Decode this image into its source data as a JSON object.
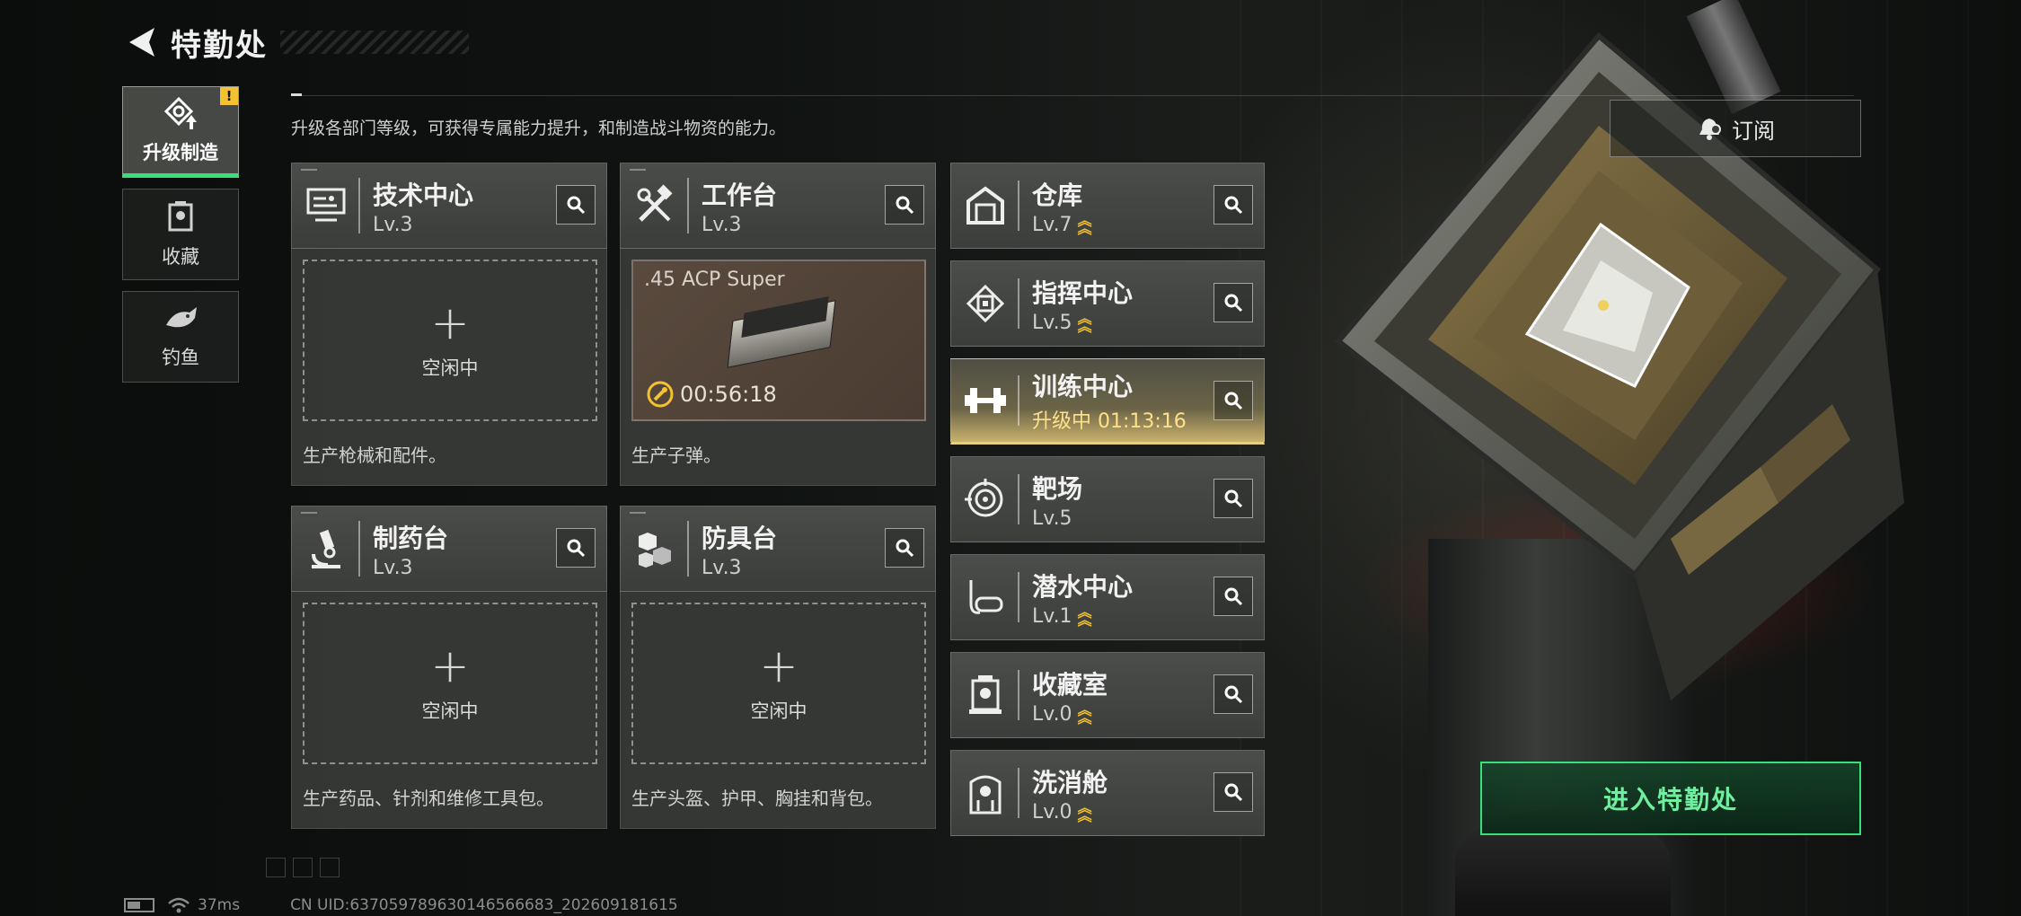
{
  "header": {
    "title": "特勤处"
  },
  "nav": {
    "items": [
      {
        "label": "升级制造",
        "badge": "!"
      },
      {
        "label": "收藏"
      },
      {
        "label": "钓鱼"
      }
    ]
  },
  "description": "升级各部门等级，可获得专属能力提升，和制造战斗物资的能力。",
  "subscribe": {
    "label": "订阅"
  },
  "production": [
    {
      "name": "技术中心",
      "level": "Lv.3",
      "slot_status": "空闲中",
      "desc": "生产枪械和配件。",
      "icon": "monitor-icon"
    },
    {
      "name": "工作台",
      "level": "Lv.3",
      "item": ".45 ACP Super",
      "timer": "00:56:18",
      "desc": "生产子弹。",
      "icon": "tools-icon"
    },
    {
      "name": "制药台",
      "level": "Lv.3",
      "slot_status": "空闲中",
      "desc": "生产药品、针剂和维修工具包。",
      "icon": "microscope-icon"
    },
    {
      "name": "防具台",
      "level": "Lv.3",
      "slot_status": "空闲中",
      "desc": "生产头盔、护甲、胸挂和背包。",
      "icon": "armor-blocks-icon"
    }
  ],
  "facilities": [
    {
      "name": "仓库",
      "level": "Lv.7",
      "upgradeable": true,
      "icon": "warehouse-icon"
    },
    {
      "name": "指挥中心",
      "level": "Lv.5",
      "upgradeable": true,
      "icon": "chip-icon"
    },
    {
      "name": "训练中心",
      "level": "升级中 01:13:16",
      "upgrading": true,
      "icon": "dumbbell-icon"
    },
    {
      "name": "靶场",
      "level": "Lv.5",
      "upgradeable": false,
      "icon": "target-icon"
    },
    {
      "name": "潜水中心",
      "level": "Lv.1",
      "upgradeable": true,
      "icon": "diving-mask-icon"
    },
    {
      "name": "收藏室",
      "level": "Lv.0",
      "upgradeable": true,
      "icon": "display-case-icon"
    },
    {
      "name": "洗消舱",
      "level": "Lv.0",
      "upgradeable": true,
      "icon": "decon-pod-icon"
    }
  ],
  "enter_button": {
    "label": "进入特勤处"
  },
  "status_bar": {
    "ping": "37ms",
    "uid": "CN UID:637059789630146566683_202609181615"
  },
  "colors": {
    "accent": "#37e07a",
    "upgrade": "#f2c230",
    "highlight": "#e6cf7d"
  }
}
